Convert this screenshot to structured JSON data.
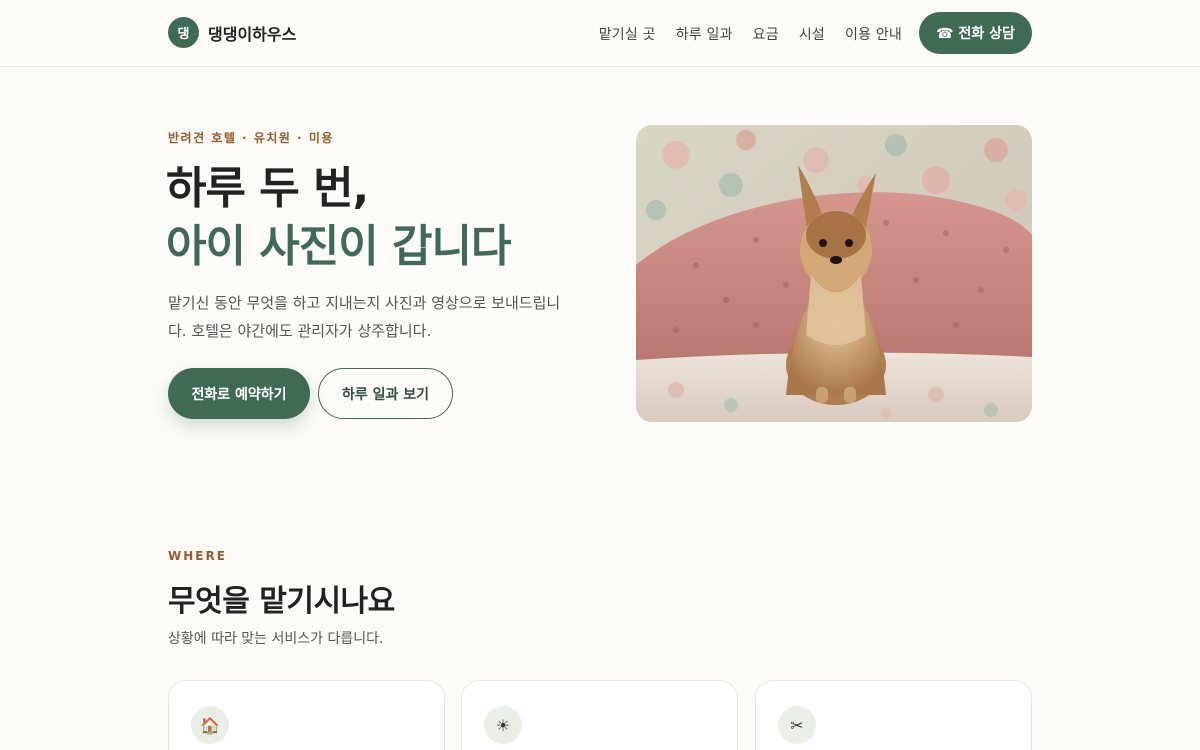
{
  "brand": {
    "logo_mark": "댕",
    "name": "댕댕이하우스",
    "accent": "#3f6b55"
  },
  "nav": {
    "items": [
      "맡기실 곳",
      "하루 일과",
      "요금",
      "시설",
      "이용 안내"
    ],
    "call_label": "☎ 전화 상담"
  },
  "hero": {
    "eyebrow": "반려견 호텔 · 유치원 · 미용",
    "title_line1": "하루 두 번,",
    "title_line2": "아이 사진이 갑니다",
    "description": "맡기신 동안 무엇을 하고 지내는지 사진과 영상으로 보내드립니다. 호텔은 야간에도 관리자가 상주합니다.",
    "primary_button": "전화로 예약하기",
    "secondary_button": "하루 일과 보기",
    "image_icon": "dog-photo"
  },
  "services": {
    "eyebrow": "WHERE",
    "title": "무엇을 맡기시나요",
    "description": "상황에 따라 맞는 서비스가 다릅니다.",
    "cards": [
      {
        "icon": "house-icon",
        "glyph": "🏠"
      },
      {
        "icon": "sun-icon",
        "glyph": "☀"
      },
      {
        "icon": "scissors-icon",
        "glyph": "✂"
      }
    ]
  }
}
